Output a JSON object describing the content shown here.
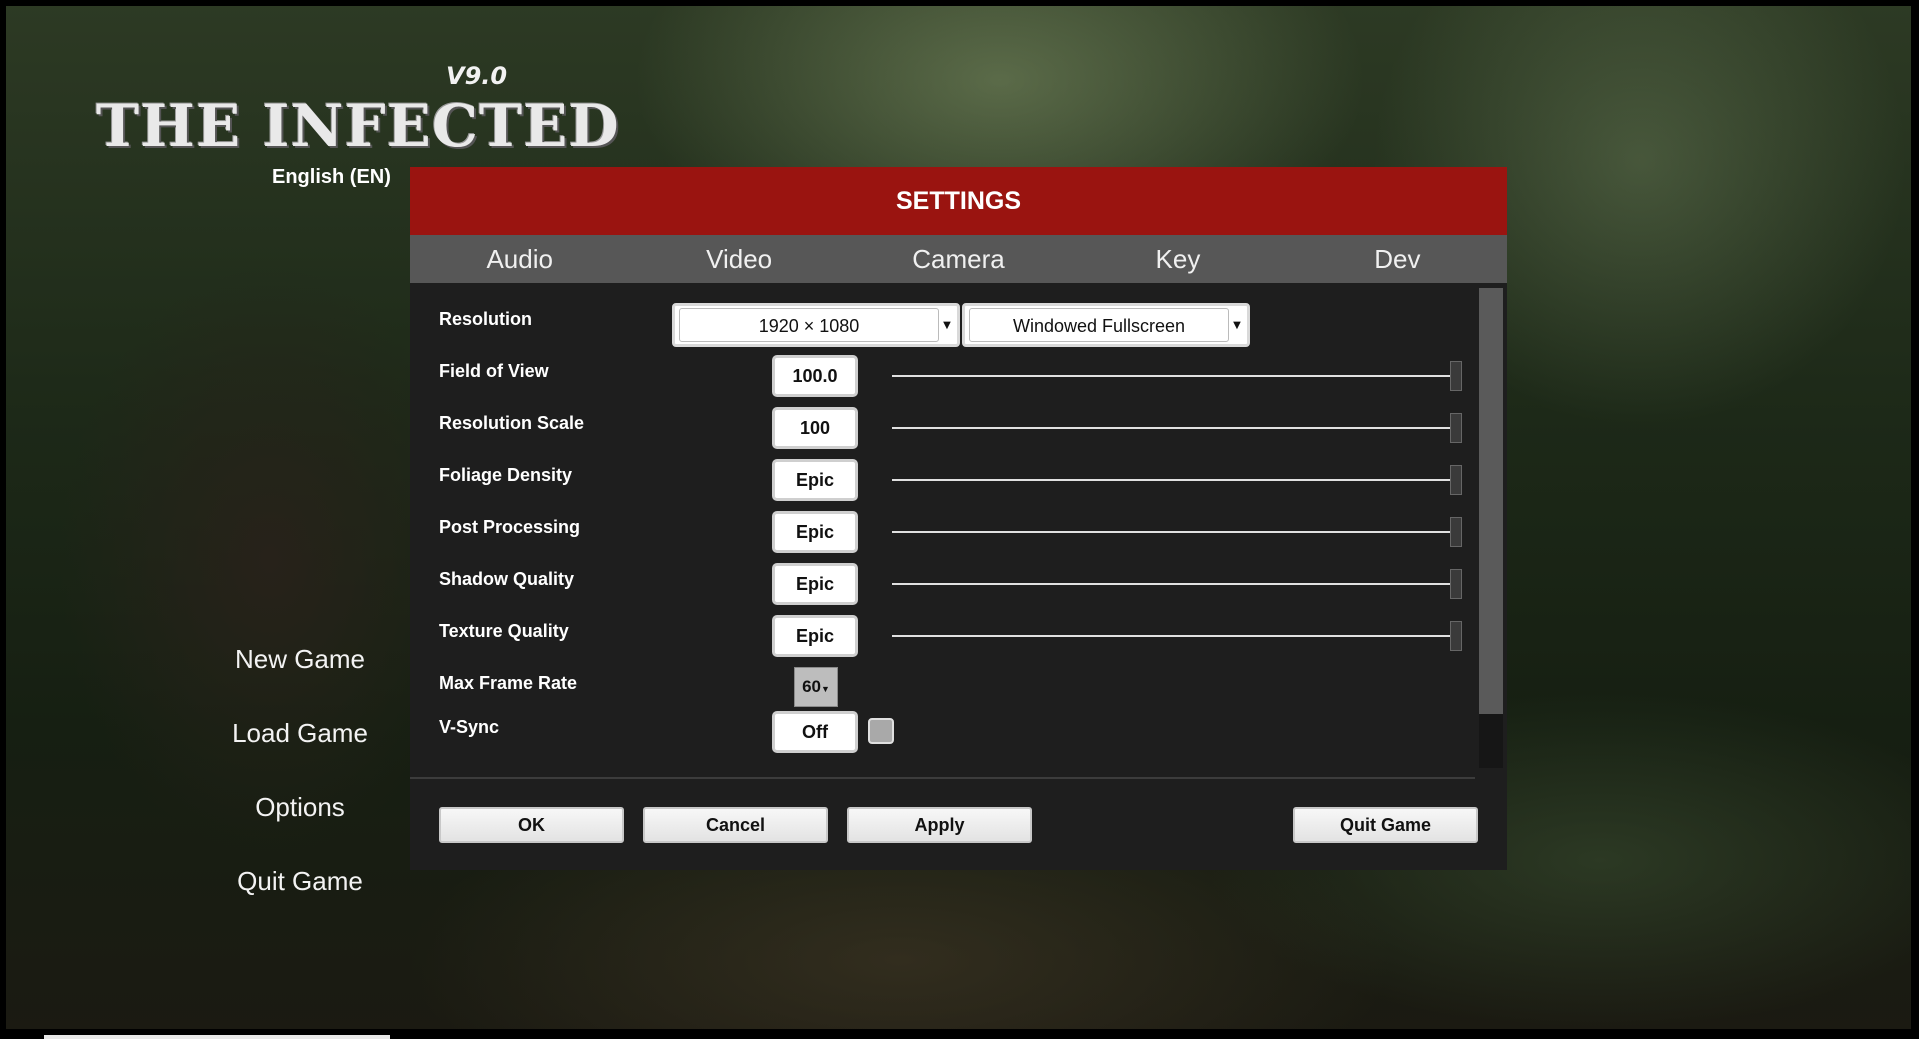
{
  "game": {
    "version": "V9.0",
    "title": "THE INFECTED",
    "language": "English (EN)"
  },
  "main_menu": {
    "items": [
      "New Game",
      "Load Game",
      "Options",
      "Quit Game"
    ]
  },
  "settings": {
    "title": "SETTINGS",
    "tabs": [
      "Audio",
      "Video",
      "Camera",
      "Key",
      "Dev"
    ],
    "resolution": {
      "label": "Resolution",
      "value": "1920 × 1080",
      "mode": "Windowed Fullscreen"
    },
    "rows": [
      {
        "label": "Field of View",
        "value": "100.0",
        "slider": 1.0
      },
      {
        "label": "Resolution Scale",
        "value": "100",
        "slider": 1.0
      },
      {
        "label": "Foliage Density",
        "value": "Epic",
        "slider": 1.0
      },
      {
        "label": "Post Processing",
        "value": "Epic",
        "slider": 1.0
      },
      {
        "label": "Shadow Quality",
        "value": "Epic",
        "slider": 1.0
      },
      {
        "label": "Texture Quality",
        "value": "Epic",
        "slider": 1.0
      }
    ],
    "max_frame_rate": {
      "label": "Max Frame Rate",
      "value": "60"
    },
    "vsync": {
      "label": "V-Sync",
      "value": "Off",
      "checked": false
    },
    "buttons": {
      "ok": "OK",
      "cancel": "Cancel",
      "apply": "Apply",
      "quit": "Quit Game"
    }
  },
  "colors": {
    "header": "#9a1410",
    "tab_bar": "#575757",
    "panel": "#1e1e1e"
  }
}
